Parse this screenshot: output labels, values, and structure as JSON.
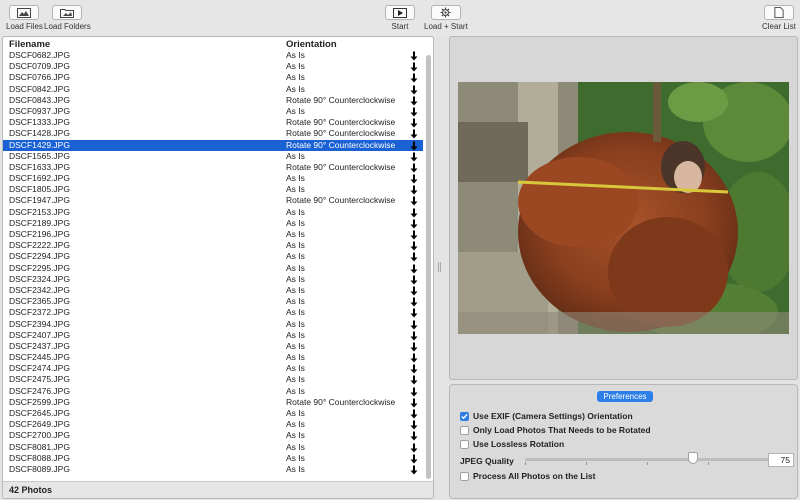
{
  "toolbar": {
    "load_files": "Load Files",
    "load_folders": "Load Folders",
    "start": "Start",
    "load_start": "Load + Start",
    "clear_list": "Clear List"
  },
  "list": {
    "header_filename": "Filename",
    "header_orientation": "Orientation",
    "rows": [
      {
        "filename": "DSCF0682.JPG",
        "orientation": "As Is"
      },
      {
        "filename": "DSCF0709.JPG",
        "orientation": "As Is"
      },
      {
        "filename": "DSCF0766.JPG",
        "orientation": "As Is"
      },
      {
        "filename": "DSCF0842.JPG",
        "orientation": "As Is"
      },
      {
        "filename": "DSCF0843.JPG",
        "orientation": "Rotate 90° Counterclockwise"
      },
      {
        "filename": "DSCF0937.JPG",
        "orientation": "As Is"
      },
      {
        "filename": "DSCF1333.JPG",
        "orientation": "Rotate 90° Counterclockwise"
      },
      {
        "filename": "DSCF1428.JPG",
        "orientation": "Rotate 90° Counterclockwise"
      },
      {
        "filename": "DSCF1429.JPG",
        "orientation": "Rotate 90° Counterclockwise",
        "selected": true
      },
      {
        "filename": "DSCF1565.JPG",
        "orientation": "As Is"
      },
      {
        "filename": "DSCF1633.JPG",
        "orientation": "Rotate 90° Counterclockwise"
      },
      {
        "filename": "DSCF1692.JPG",
        "orientation": "As Is"
      },
      {
        "filename": "DSCF1805.JPG",
        "orientation": "As Is"
      },
      {
        "filename": "DSCF1947.JPG",
        "orientation": "Rotate 90° Counterclockwise"
      },
      {
        "filename": "DSCF2153.JPG",
        "orientation": "As Is"
      },
      {
        "filename": "DSCF2189.JPG",
        "orientation": "As Is"
      },
      {
        "filename": "DSCF2196.JPG",
        "orientation": "As Is"
      },
      {
        "filename": "DSCF2222.JPG",
        "orientation": "As Is"
      },
      {
        "filename": "DSCF2294.JPG",
        "orientation": "As Is"
      },
      {
        "filename": "DSCF2295.JPG",
        "orientation": "As Is"
      },
      {
        "filename": "DSCF2324.JPG",
        "orientation": "As Is"
      },
      {
        "filename": "DSCF2342.JPG",
        "orientation": "As Is"
      },
      {
        "filename": "DSCF2365.JPG",
        "orientation": "As Is"
      },
      {
        "filename": "DSCF2372.JPG",
        "orientation": "As Is"
      },
      {
        "filename": "DSCF2394.JPG",
        "orientation": "As Is"
      },
      {
        "filename": "DSCF2407.JPG",
        "orientation": "As Is"
      },
      {
        "filename": "DSCF2437.JPG",
        "orientation": "As Is"
      },
      {
        "filename": "DSCF2445.JPG",
        "orientation": "As Is"
      },
      {
        "filename": "DSCF2474.JPG",
        "orientation": "As Is"
      },
      {
        "filename": "DSCF2475.JPG",
        "orientation": "As Is"
      },
      {
        "filename": "DSCF2476.JPG",
        "orientation": "As Is"
      },
      {
        "filename": "DSCF2599.JPG",
        "orientation": "Rotate 90° Counterclockwise"
      },
      {
        "filename": "DSCF2645.JPG",
        "orientation": "As Is"
      },
      {
        "filename": "DSCF2649.JPG",
        "orientation": "As Is"
      },
      {
        "filename": "DSCF2700.JPG",
        "orientation": "As Is"
      },
      {
        "filename": "DSCF8081.JPG",
        "orientation": "As Is"
      },
      {
        "filename": "DSCF8088.JPG",
        "orientation": "As Is"
      },
      {
        "filename": "DSCF8089.JPG",
        "orientation": "As Is"
      }
    ]
  },
  "status": {
    "count_text": "42 Photos"
  },
  "preferences": {
    "tab_label": "Preferences",
    "use_exif": {
      "label": "Use EXIF (Camera Settings) Orientation",
      "checked": true
    },
    "only_rotated": {
      "label": "Only Load Photos That Needs to be Rotated",
      "checked": false
    },
    "lossless": {
      "label": "Use Lossless Rotation",
      "checked": false
    },
    "jpeg_quality_label": "JPEG Quality",
    "jpeg_quality_value": "75",
    "process_all": {
      "label": "Process All Photos on the List",
      "checked": false
    }
  },
  "colors": {
    "selection": "#1a62d3",
    "accent": "#2c7fe7"
  },
  "icons": {
    "load_files": "image-icon",
    "load_folders": "folder-image-icon",
    "start": "play-icon",
    "load_start": "gear-icon",
    "clear_list": "document-icon",
    "row_action": "down-arrow-icon"
  }
}
